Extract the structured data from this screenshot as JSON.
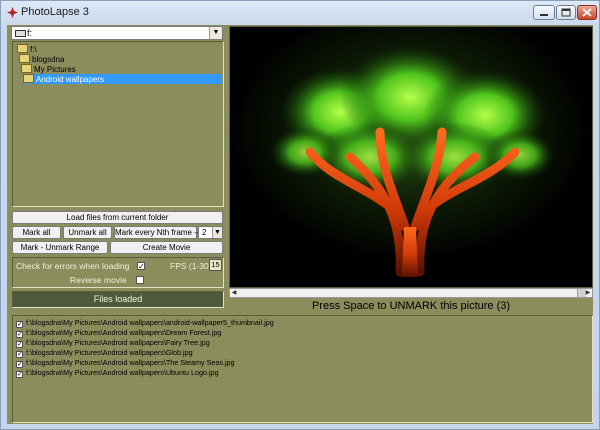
{
  "window": {
    "title": "PhotoLapse 3"
  },
  "drive": {
    "label": "f:"
  },
  "folder_tree": {
    "items": [
      {
        "label": "f:\\"
      },
      {
        "label": "blogsdna"
      },
      {
        "label": "My Pictures"
      },
      {
        "label": "Android wallpapers"
      }
    ],
    "selected_index": 3
  },
  "buttons": {
    "load_files": "Load files from current folder",
    "mark_all": "Mark all",
    "unmark_all": "Unmark all",
    "mark_every_nth": "Mark every Nth frame -->",
    "nth_value": "2",
    "mark_unmark_range": "Mark - Unmark Range",
    "create_movie": "Create Movie"
  },
  "options": {
    "check_errors_label": "Check for errors when loading",
    "check_errors_checked": true,
    "fps_label": "FPS (1-30)",
    "fps_value": "15",
    "reverse_movie_label": "Reverse movie",
    "reverse_movie_checked": false
  },
  "status": {
    "text": "Files loaded"
  },
  "preview": {
    "hint": "Press Space to UNMARK this picture (3)"
  },
  "files": [
    {
      "path": "f:\\blogsdna\\My Pictures\\Android wallpapers\\android-wallpaper5_thumbnail.jpg",
      "checked": true
    },
    {
      "path": "f:\\blogsdna\\My Pictures\\Android wallpapers\\Dream Forest.jpg",
      "checked": true
    },
    {
      "path": "f:\\blogsdna\\My Pictures\\Android wallpapers\\Fairy Tree.jpg",
      "checked": true
    },
    {
      "path": "f:\\blogsdna\\My Pictures\\Android wallpapers\\Glob.jpg",
      "checked": true
    },
    {
      "path": "f:\\blogsdna\\My Pictures\\Android wallpapers\\The Steamy Seas.jpg",
      "checked": true
    },
    {
      "path": "f:\\blogsdna\\My Pictures\\Android wallpapers\\Ubuntu Logo.jpg",
      "checked": true
    }
  ],
  "colors": {
    "panel": "#8b8d5d",
    "selection": "#3399ff",
    "status_bg": "#4e5a3a"
  }
}
